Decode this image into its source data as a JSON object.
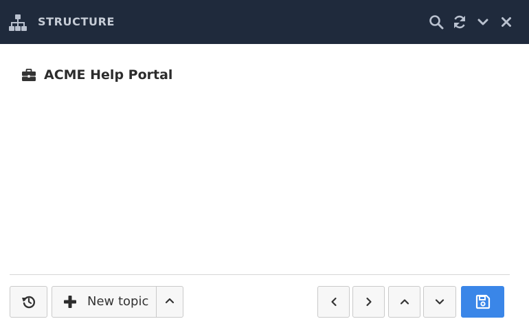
{
  "header": {
    "title": "STRUCTURE",
    "icon": "sitemap-icon",
    "actions": [
      "search-icon",
      "refresh-icon",
      "chevron-down-icon",
      "close-icon"
    ]
  },
  "tree": {
    "root_label": "ACME Help Portal",
    "root_icon": "briefcase-icon"
  },
  "footer": {
    "history_icon": "history-icon",
    "new_topic_label": "New topic",
    "new_topic_icon": "plus-icon",
    "more_icon": "chevron-up-icon",
    "nav_icons": [
      "chevron-left-icon",
      "chevron-right-icon",
      "chevron-up-icon",
      "chevron-down-icon"
    ],
    "save_icon": "save-icon"
  },
  "colors": {
    "header_bg": "#1f2a3c",
    "header_text": "#c6ccd6",
    "header_icon": "#b9c1cf",
    "accent": "#3a86e8",
    "button_bg": "#f7f7f7",
    "button_border": "#c9c9c9"
  }
}
